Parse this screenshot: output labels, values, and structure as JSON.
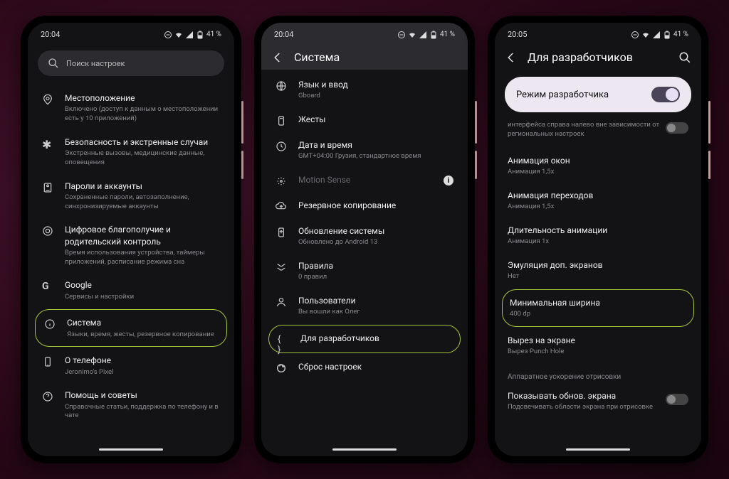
{
  "statusbar_icons_battery_text": "41 %",
  "phone1": {
    "time": "20:04",
    "search_placeholder": "Поиск настроек",
    "items": [
      {
        "icon": "location",
        "label": "Местоположение",
        "sub": "Включено (доступ к данным о местоположении есть у 10 приложений)"
      },
      {
        "icon": "emergency",
        "label": "Безопасность и экстренные случаи",
        "sub": "Экстренные вызовы, медицинские данные, оповещения"
      },
      {
        "icon": "key",
        "label": "Пароли и аккаунты",
        "sub": "Сохраненные пароли, автозаполнение, синхронизируемые аккаунты"
      },
      {
        "icon": "wellbeing",
        "label": "Цифровое благополучие и родительский контроль",
        "sub": "Время использования устройства, таймеры приложений, расписание режима сна"
      },
      {
        "icon": "google",
        "label": "Google",
        "sub": "Сервисы и настройки"
      },
      {
        "icon": "info",
        "label": "Система",
        "sub": "Языки, время, жесты, резервное копирование",
        "highlight": true
      },
      {
        "icon": "phone",
        "label": "О телефоне",
        "sub": "Jeronimo's Pixel"
      },
      {
        "icon": "help",
        "label": "Помощь и советы",
        "sub": "Справочные статьи, поддержка по телефону и в чате"
      }
    ]
  },
  "phone2": {
    "time": "20:04",
    "title": "Система",
    "items": [
      {
        "icon": "language",
        "label": "Язык и ввод",
        "sub": "Gboard"
      },
      {
        "icon": "gesture",
        "label": "Жесты",
        "sub": ""
      },
      {
        "icon": "clock",
        "label": "Дата и время",
        "sub": "GMT+04:00 Грузия, стандартное время"
      },
      {
        "icon": "motion",
        "label": "Motion Sense",
        "sub": "",
        "dim": true,
        "info": true
      },
      {
        "icon": "backup",
        "label": "Резервное копирование",
        "sub": ""
      },
      {
        "icon": "update",
        "label": "Обновление системы",
        "sub": "Обновлено до Android 13"
      },
      {
        "icon": "rules",
        "label": "Правила",
        "sub": "0 правил"
      },
      {
        "icon": "user",
        "label": "Пользователи",
        "sub": "Вы вошли как Олег"
      },
      {
        "icon": "braces",
        "label": "Для разработчиков",
        "sub": "",
        "highlight": true
      },
      {
        "icon": "reset",
        "label": "Сброс настроек",
        "sub": ""
      }
    ]
  },
  "phone3": {
    "time": "20:05",
    "title": "Для разработчиков",
    "dev_mode_label": "Режим разработчика",
    "partial_sub": "интерфейса справа налево вне зависимости от региональных настроек",
    "items": [
      {
        "label": "Анимация окон",
        "sub": "Анимация 1,5x"
      },
      {
        "label": "Анимация переходов",
        "sub": "Анимация 1,5x"
      },
      {
        "label": "Длительность анимации",
        "sub": "Анимация 1x"
      },
      {
        "label": "Эмуляция доп. экранов",
        "sub": "Нет"
      },
      {
        "label": "Минимальная ширина",
        "sub": "400 dp",
        "highlight": true
      },
      {
        "label": "Вырез на экране",
        "sub": "Вырез Punch Hole"
      }
    ],
    "section": "Аппаратное ускорение отрисовки",
    "last": {
      "label": "Показывать обнов. экрана",
      "sub": "Подсвечивать области экрана при отрисовке"
    }
  }
}
